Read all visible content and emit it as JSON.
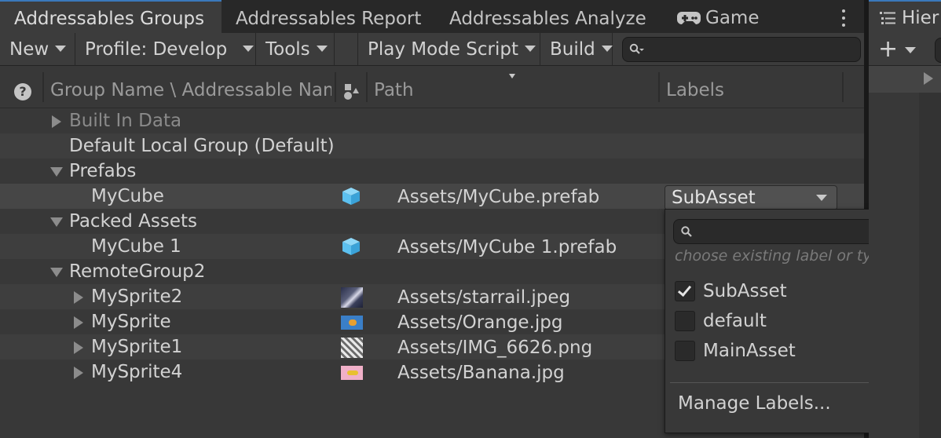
{
  "tabs": [
    {
      "label": "Addressables Groups",
      "active": true
    },
    {
      "label": "Addressables Report"
    },
    {
      "label": "Addressables Analyze"
    },
    {
      "label": "Game",
      "icon": "gamepad-icon"
    }
  ],
  "toolbar": {
    "new_label": "New",
    "profile_label": "Profile: Develop",
    "tools_label": "Tools",
    "play_mode_label": "Play Mode Script",
    "build_label": "Build",
    "search_placeholder": ""
  },
  "columns": {
    "help": "?",
    "group_name": "Group Name \\ Addressable Nam",
    "path": "Path",
    "labels": "Labels"
  },
  "rows": [
    {
      "name": "Built In Data",
      "expand": "collapsed",
      "disabled": true
    },
    {
      "name": "Default Local Group (Default)"
    },
    {
      "name": "Prefabs",
      "expand": "expanded"
    },
    {
      "name": "MyCube",
      "icon": "cube-icon",
      "path": "Assets/MyCube.prefab",
      "label": "SubAsset",
      "selected": true
    },
    {
      "name": "Packed Assets",
      "expand": "expanded"
    },
    {
      "name": "MyCube 1",
      "icon": "cube-icon",
      "path": "Assets/MyCube 1.prefab"
    },
    {
      "name": "RemoteGroup2",
      "expand": "expanded"
    },
    {
      "name": "MySprite2",
      "expand": "collapsed",
      "icon": "sprite-thumbnail",
      "path": "Assets/starrail.jpeg"
    },
    {
      "name": "MySprite",
      "expand": "collapsed",
      "icon": "sprite-thumbnail",
      "path": "Assets/Orange.jpg"
    },
    {
      "name": "MySprite1",
      "expand": "collapsed",
      "icon": "sprite-thumbnail",
      "path": "Assets/IMG_6626.png"
    },
    {
      "name": "MySprite4",
      "expand": "collapsed",
      "icon": "sprite-thumbnail",
      "path": "Assets/Banana.jpg"
    }
  ],
  "label_popup": {
    "search_placeholder": "",
    "hint": "choose existing label or type to c",
    "options": [
      {
        "label": "SubAsset",
        "checked": true
      },
      {
        "label": "default",
        "checked": false
      },
      {
        "label": "MainAsset",
        "checked": false
      }
    ],
    "manage_label": "Manage Labels..."
  },
  "hierarchy": {
    "tab_label": "Hier",
    "add_label": "+"
  },
  "colors": {
    "accent": "#3a79bb",
    "cube": "#5cc0ef"
  }
}
